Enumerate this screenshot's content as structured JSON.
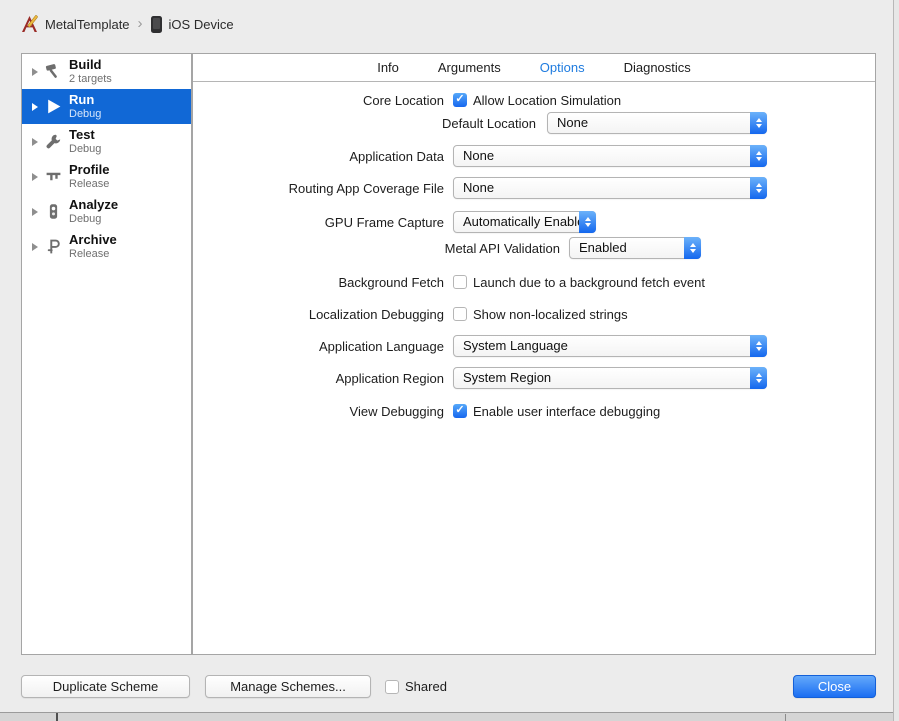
{
  "colors": {
    "selection_blue": "#1168d6",
    "tab_active_blue": "#1e7bdf",
    "control_blue_top": "#6cb2fa",
    "control_blue_bottom": "#1467ee",
    "close_button_blue": "#1b6ef2",
    "dialog_background": "#ececec"
  },
  "glyphs": {
    "check": "✓"
  },
  "breadcrumb": {
    "project": "MetalTemplate",
    "separator": "›",
    "device": "iOS Device",
    "project_icon": "xcode-scheme-icon",
    "device_icon": "ios-device-icon"
  },
  "sidebar": {
    "items": [
      {
        "title": "Build",
        "subtitle": "2 targets",
        "icon": "hammer-icon",
        "selected": false
      },
      {
        "title": "Run",
        "subtitle": "Debug",
        "icon": "play-icon",
        "selected": true
      },
      {
        "title": "Test",
        "subtitle": "Debug",
        "icon": "wrench-icon",
        "selected": false
      },
      {
        "title": "Profile",
        "subtitle": "Release",
        "icon": "caliper-icon",
        "selected": false
      },
      {
        "title": "Analyze",
        "subtitle": "Debug",
        "icon": "analyze-icon",
        "selected": false
      },
      {
        "title": "Archive",
        "subtitle": "Release",
        "icon": "flag-icon",
        "selected": false
      }
    ]
  },
  "tabs": {
    "items": [
      {
        "label": "Info",
        "selected": false
      },
      {
        "label": "Arguments",
        "selected": false
      },
      {
        "label": "Options",
        "selected": true
      },
      {
        "label": "Diagnostics",
        "selected": false
      }
    ]
  },
  "form": {
    "rows": [
      {
        "label": "Core Location",
        "control": "checkbox",
        "checked": true,
        "text": "Allow Location Simulation"
      },
      {
        "label": "Default Location",
        "control": "popup",
        "value": "None"
      },
      {
        "label": "Application Data",
        "control": "popup",
        "value": "None"
      },
      {
        "label": "Routing App Coverage File",
        "control": "popup",
        "value": "None"
      },
      {
        "label": "GPU Frame Capture",
        "control": "popup",
        "value": "Automatically Enabled"
      },
      {
        "label": "Metal API Validation",
        "control": "popup",
        "value": "Enabled"
      },
      {
        "label": "Background Fetch",
        "control": "checkbox",
        "checked": false,
        "text": "Launch due to a background fetch event"
      },
      {
        "label": "Localization Debugging",
        "control": "checkbox",
        "checked": false,
        "text": "Show non-localized strings"
      },
      {
        "label": "Application Language",
        "control": "popup",
        "value": "System Language"
      },
      {
        "label": "Application Region",
        "control": "popup",
        "value": "System Region"
      },
      {
        "label": "View Debugging",
        "control": "checkbox",
        "checked": true,
        "text": "Enable user interface debugging"
      }
    ]
  },
  "footer": {
    "duplicate": "Duplicate Scheme",
    "manage": "Manage Schemes...",
    "shared_label": "Shared",
    "shared_checked": false,
    "close": "Close"
  }
}
